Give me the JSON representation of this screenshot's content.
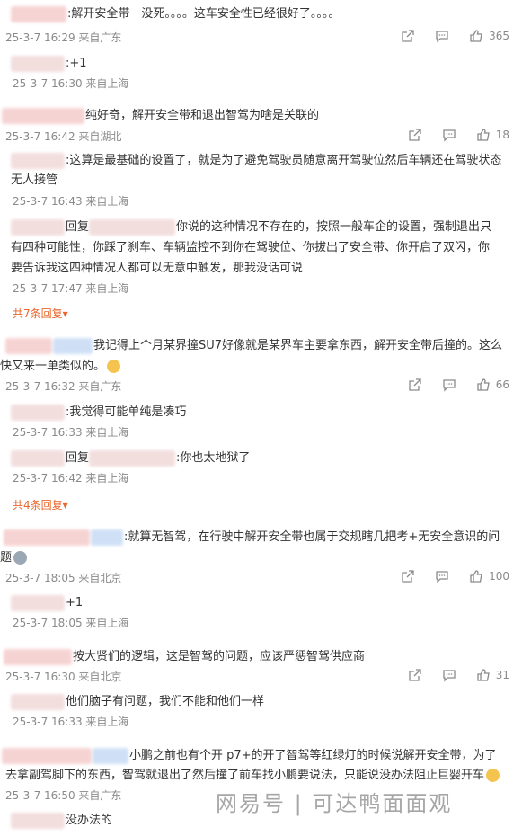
{
  "comments": [
    {
      "text": ":解开安全带　没死。。。。这车安全性已经很好了。。。。",
      "meta": "25-3-7 16:29 来自广东",
      "likes": "365",
      "replies": [
        {
          "text": ":+1",
          "meta": "25-3-7 16:30 来自上海"
        }
      ]
    },
    {
      "text": "纯好奇，解开安全带和退出智驾为啥是关联的",
      "meta": "25-3-7 16:42 来自湖北",
      "likes": "18",
      "replies": [
        {
          "text": ":这算是最基础的设置了，就是为了避免驾驶员随意离开驾驶位然后车辆还在驾驶状态",
          "text2": "无人接管",
          "meta": "25-3-7 16:43 来自上海"
        },
        {
          "text": "你说的这种情况不存在的，按照一般车企的设置，强制退出只",
          "prefix": "回复",
          "text2": "有四种可能性，你踩了刹车、车辆监控不到你在驾驶位、你拔出了安全带、你开启了双闪，你",
          "text3": "要告诉我这四种情况人都可以无意中触发，那我没话可说",
          "meta": "25-3-7 17:47 来自上海"
        }
      ],
      "more": "共7条回复▾"
    },
    {
      "text": "我记得上个月某界撞SU7好像就是某界车主要拿东西，解开安全带后撞的。这么",
      "text2": "快又来一单类似的。",
      "meta": "25-3-7 16:32 来自广东",
      "likes": "66",
      "replies": [
        {
          "text": ":我觉得可能单纯是凑巧",
          "meta": "25-3-7 16:33 来自上海"
        },
        {
          "prefix": "回复",
          "text": ":你也太地狱了",
          "meta": "25-3-7 16:42 来自上海"
        }
      ],
      "more": "共4条回复▾"
    },
    {
      "text": ":就算无智驾，在行驶中解开安全带也属于交规瞎几把考+无安全意识的问",
      "text2": "题",
      "meta": "25-3-7 18:05 来自北京",
      "likes": "100",
      "replies": [
        {
          "text": "+1",
          "meta": "25-3-7 18:05 来自上海"
        }
      ]
    },
    {
      "text": "按大贤们的逻辑，这是智驾的问题，应该严惩智驾供应商",
      "meta": "25-3-7 16:30 来自北京",
      "likes": "31",
      "replies": [
        {
          "text": "他们脑子有问题，我们不能和他们一样",
          "meta": "25-3-7 16:33 来自上海"
        }
      ]
    },
    {
      "text": "小鹏之前也有个开 p7+的开了智驾等红绿灯的时候说解开安全带，为了",
      "text2": "去拿副驾脚下的东西，智驾就退出了然后撞了前车找小鹏要说法，只能说没办法阻止巨婴开车",
      "meta": "25-3-7 16:50 来自广东",
      "replies": [
        {
          "text": "没办法的"
        }
      ]
    }
  ],
  "watermark": "网易号 | 可达鸭面面观",
  "colors": {
    "meta": "#8a8a8a",
    "more": "#e8672c",
    "text": "#333333"
  }
}
